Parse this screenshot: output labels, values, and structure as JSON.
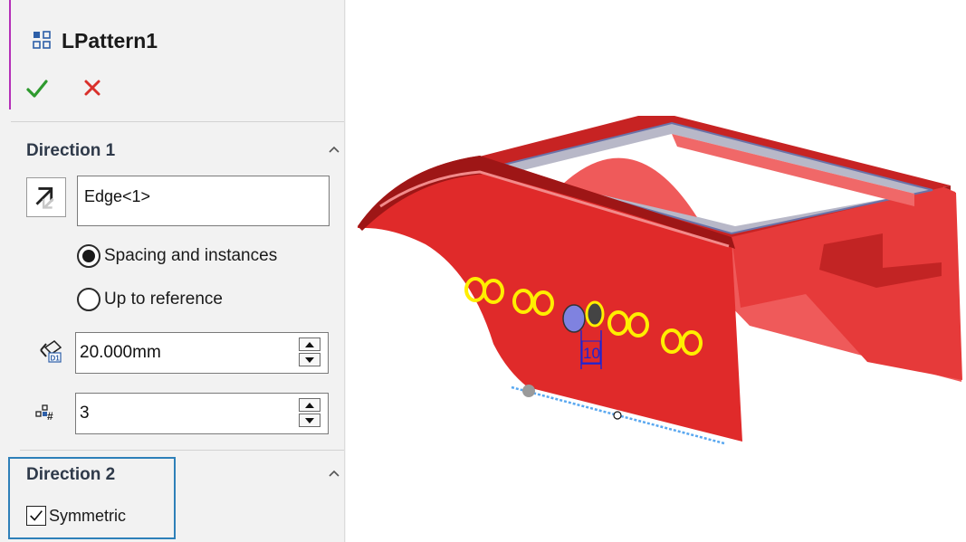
{
  "feature": {
    "title": "LPattern1",
    "icon": "linear-pattern-icon"
  },
  "actions": {
    "ok_icon": "checkmark-icon",
    "cancel_icon": "close-x-icon"
  },
  "direction1": {
    "title": "Direction 1",
    "edge_value": "Edge<1>",
    "radio_spacing_label": "Spacing and instances",
    "radio_upto_label": "Up to reference",
    "selected_option": "Spacing and instances",
    "spacing_value": "20.000mm",
    "instances_value": "3"
  },
  "direction2": {
    "title": "Direction 2",
    "symmetric_label": "Symmetric",
    "symmetric_checked": true
  },
  "viewport": {
    "dimension_label": "10"
  },
  "colors": {
    "accent": "#b42fb8",
    "ok": "#2e9a2e",
    "cancel": "#d9302b",
    "highlight": "#2e80b9",
    "part": "#e02a2a",
    "pattern_preview": "#ffee00"
  }
}
